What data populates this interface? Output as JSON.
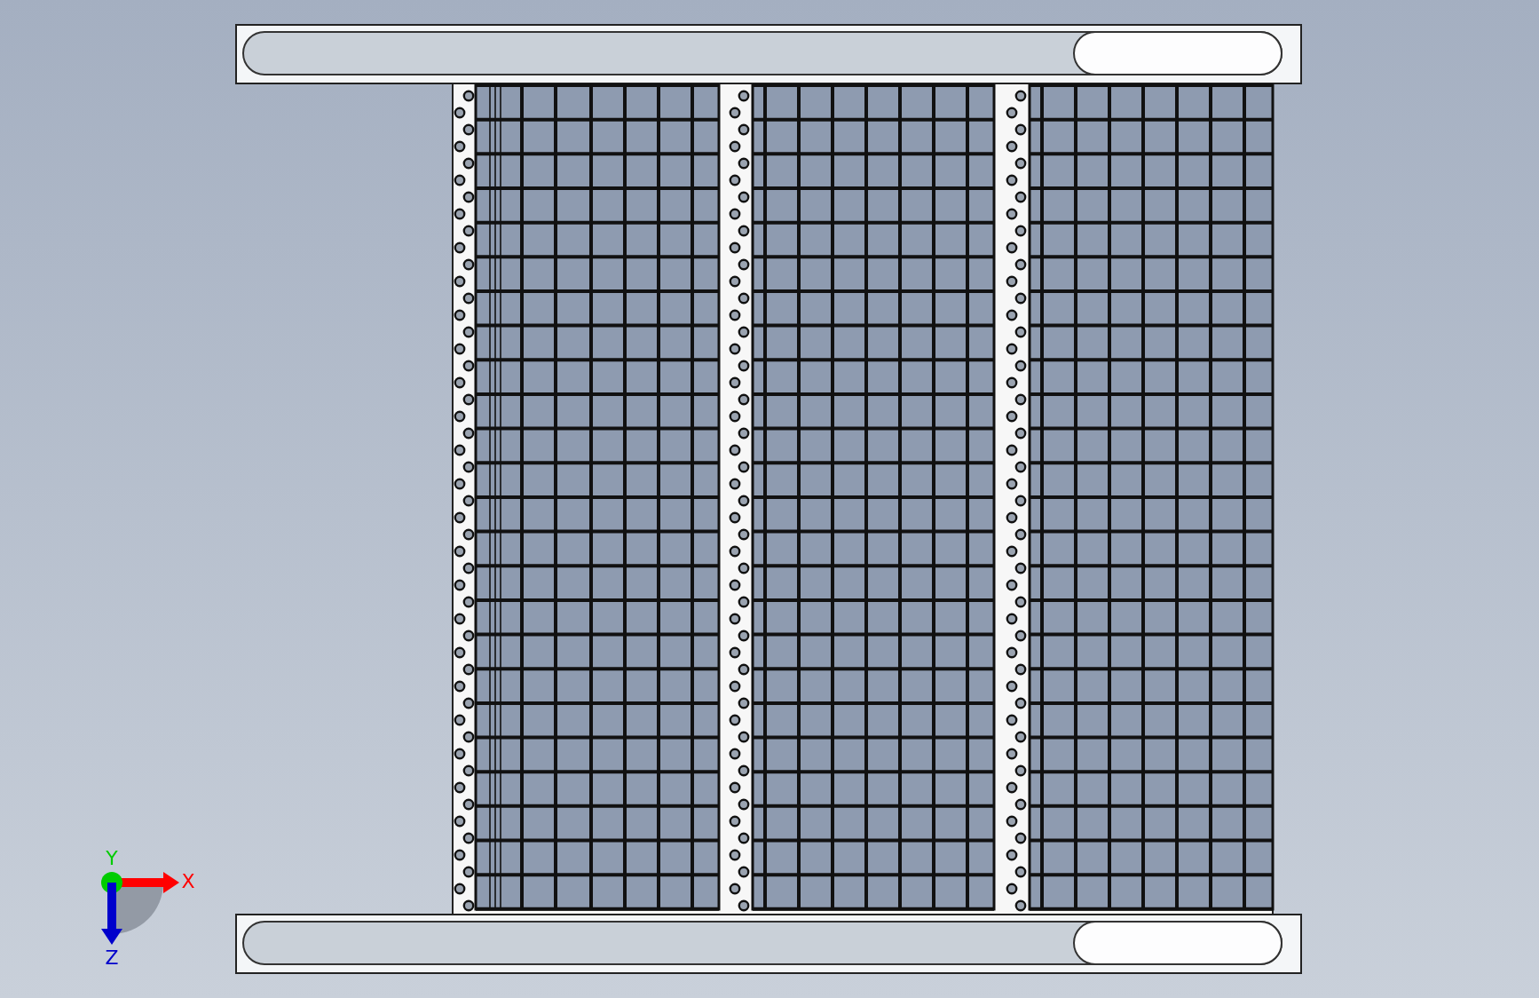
{
  "viewport": {
    "triad": {
      "axes": [
        {
          "kind": "x",
          "label": "X",
          "color": "#ff0000"
        },
        {
          "kind": "y",
          "label": "Y",
          "color": "#00cc00"
        },
        {
          "kind": "z",
          "label": "Z",
          "color": "#0000cc"
        }
      ]
    }
  }
}
